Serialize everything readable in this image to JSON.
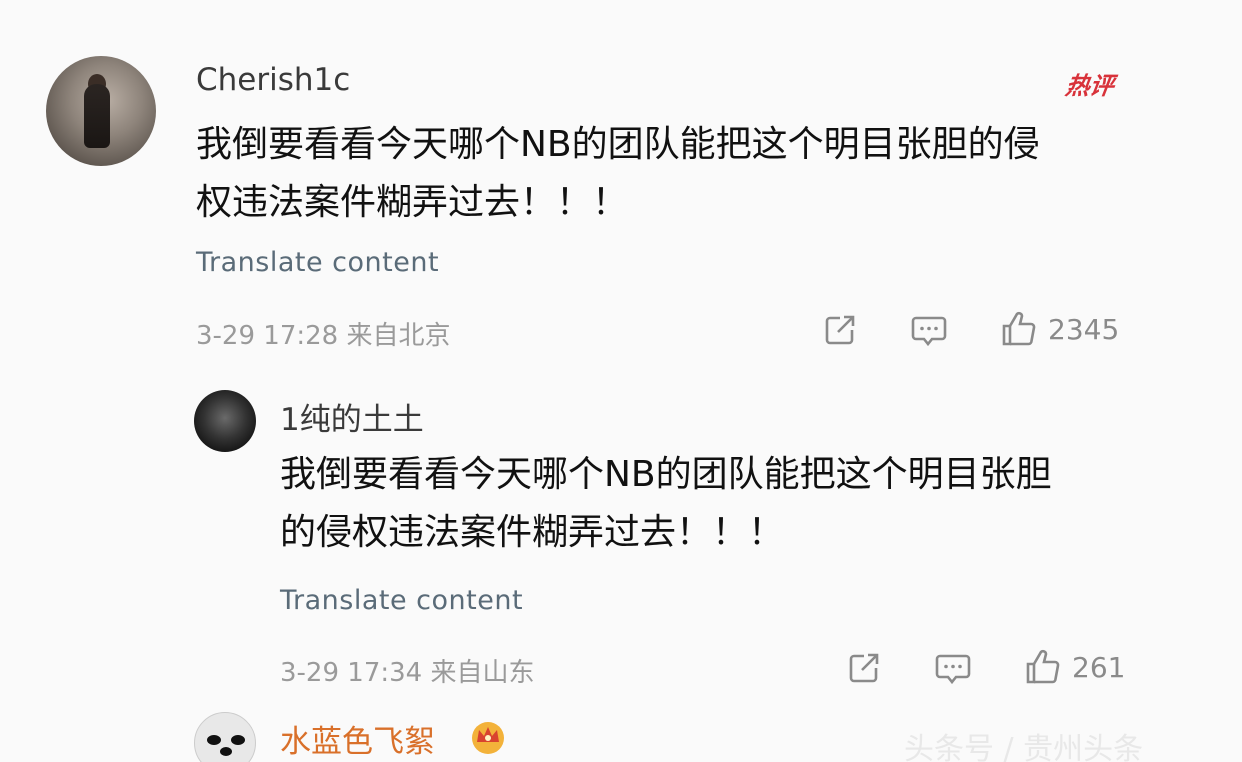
{
  "comments": [
    {
      "username": "Cherish1c",
      "badge": "热评",
      "text_line1": "我倒要看看今天哪个NB的团队能把这个明目张胆的侵",
      "text_line2": "权违法案件糊弄过去！！！",
      "translate": "Translate content",
      "timestamp": "3-29 17:28  来自北京",
      "likes": "2345"
    },
    {
      "username": "1纯的土土",
      "text_line1": "我倒要看看今天哪个NB的团队能把这个明目张胆",
      "text_line2": "的侵权违法案件糊弄过去！！！",
      "translate": "Translate content",
      "timestamp": "3-29 17:34  来自山东",
      "likes": "261"
    },
    {
      "username": "水蓝色飞絮"
    }
  ],
  "watermark": "头条号 / 贵州头条",
  "icons": {
    "share": "share-icon",
    "comment": "comment-icon",
    "like": "thumb-up-icon",
    "crown": "crown-badge-icon"
  },
  "colors": {
    "badge": "#d8323a",
    "vip_name": "#d9702a",
    "translate": "#5a6b78",
    "meta": "#9a9a9a"
  }
}
